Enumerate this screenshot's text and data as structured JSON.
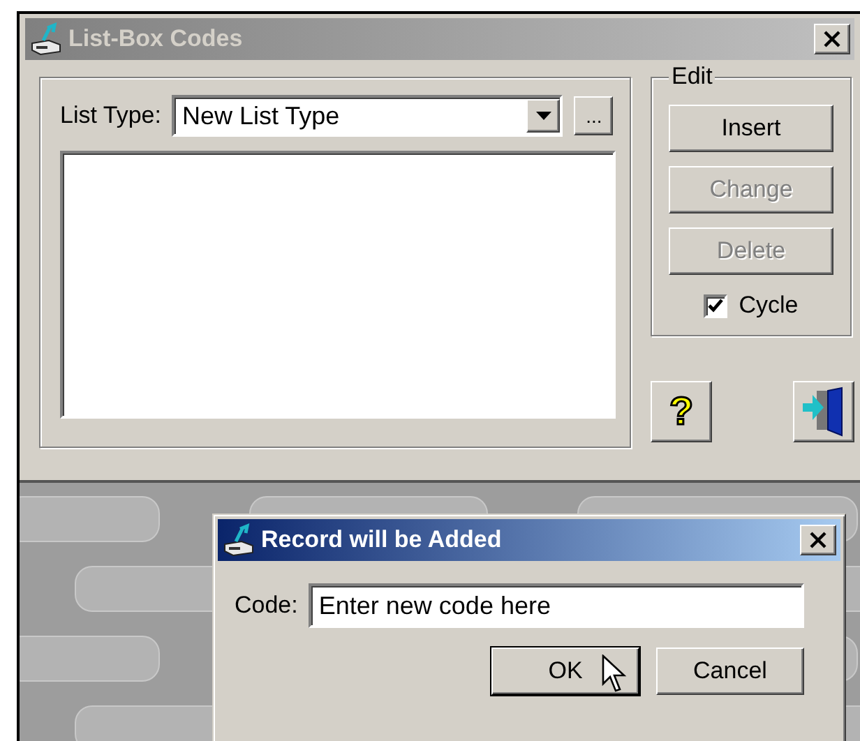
{
  "main_window": {
    "title": "List-Box Codes",
    "active": false,
    "list_type": {
      "label": "List Type:",
      "value": "New List Type",
      "more_button": "..."
    },
    "edit_group": {
      "title": "Edit",
      "buttons": [
        {
          "label": "Insert",
          "disabled": false
        },
        {
          "label": "Change",
          "disabled": true
        },
        {
          "label": "Delete",
          "disabled": true
        }
      ],
      "cycle": {
        "label": "Cycle",
        "checked": true
      }
    },
    "help_button": {
      "glyph": "?"
    }
  },
  "dialog": {
    "title": "Record will be Added",
    "active": true,
    "code": {
      "label": "Code:",
      "value": "Enter new code here"
    },
    "buttons": [
      {
        "label": "OK",
        "default": true
      },
      {
        "label": "Cancel",
        "default": false
      }
    ]
  }
}
